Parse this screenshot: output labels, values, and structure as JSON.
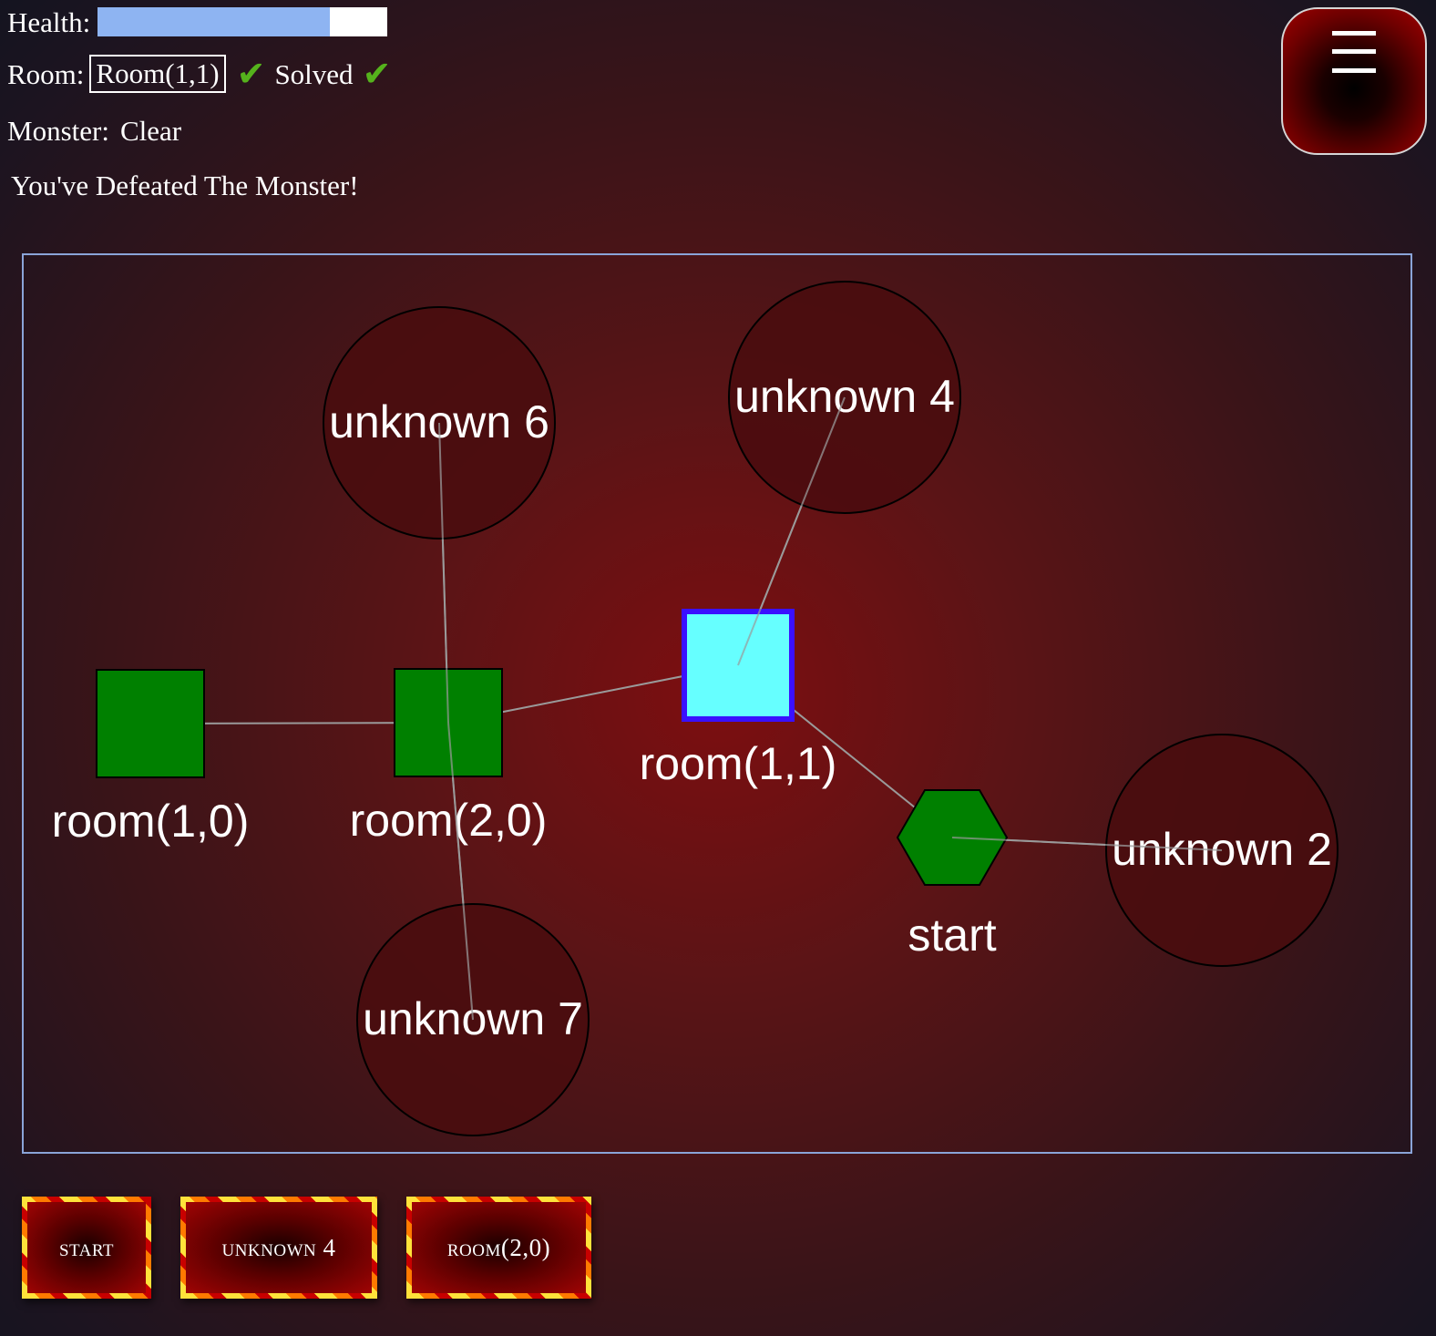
{
  "hud": {
    "health_label": "Health:",
    "health_fraction": 0.8,
    "room_label": "Room:",
    "room_value": "Room(1,1)",
    "room_check": "✔",
    "solved_label": "Solved",
    "solved_check": "✔",
    "monster_label": "Monster:",
    "monster_value": "Clear",
    "message": "You've Defeated The Monster!"
  },
  "menu": {
    "icon": "hamburger-menu-icon"
  },
  "map": {
    "nodes": [
      {
        "id": "unknown6",
        "label": "unknown 6",
        "shape": "circle",
        "fill": "#4a0c0e"
      },
      {
        "id": "unknown4",
        "label": "unknown 4",
        "shape": "circle",
        "fill": "#4a0c0e"
      },
      {
        "id": "room10",
        "label": "room(1,0)",
        "shape": "square",
        "fill": "#008000"
      },
      {
        "id": "room20",
        "label": "room(2,0)",
        "shape": "square",
        "fill": "#008000"
      },
      {
        "id": "room11",
        "label": "room(1,1)",
        "shape": "square",
        "fill": "#66ffff",
        "border": "#3a10ff",
        "current": true
      },
      {
        "id": "start",
        "label": "start",
        "shape": "hexagon",
        "fill": "#008000"
      },
      {
        "id": "unknown2",
        "label": "unknown 2",
        "shape": "circle",
        "fill": "#4a0c0e"
      },
      {
        "id": "unknown7",
        "label": "unknown 7",
        "shape": "circle",
        "fill": "#4a0c0e"
      }
    ],
    "edges": [
      [
        "room10",
        "room20"
      ],
      [
        "room20",
        "unknown6"
      ],
      [
        "room20",
        "unknown7"
      ],
      [
        "room20",
        "room11"
      ],
      [
        "room11",
        "unknown4"
      ],
      [
        "room11",
        "start"
      ],
      [
        "start",
        "unknown2"
      ]
    ]
  },
  "nav_buttons": [
    {
      "label": "start"
    },
    {
      "label": "unknown 4"
    },
    {
      "label": "room(2,0)"
    }
  ],
  "colors": {
    "health_fill": "#8eb4f2",
    "visited_room": "#008000",
    "current_room": "#66ffff",
    "current_room_border": "#3a10ff",
    "unknown_room": "#4a0c0e",
    "edge": "#9a9a9a",
    "check": "#55b21c"
  }
}
